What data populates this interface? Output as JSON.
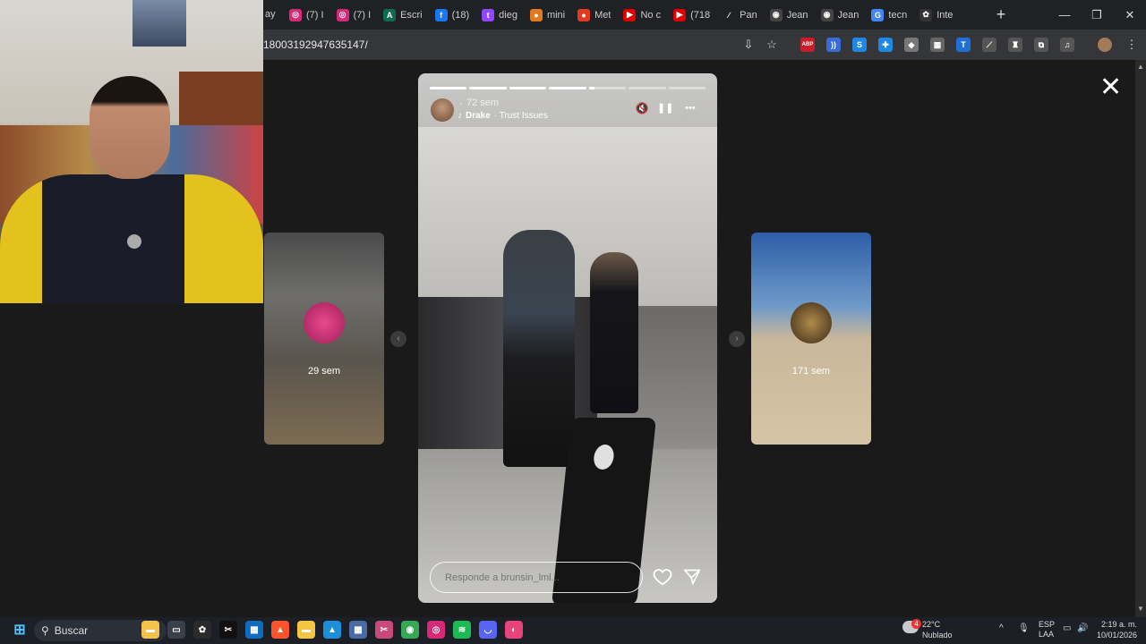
{
  "browser": {
    "tabs": [
      {
        "icon": "instagram-icon",
        "color": "#d62976",
        "letter": "◎",
        "label": "(7) I"
      },
      {
        "icon": "instagram-icon",
        "color": "#d62976",
        "letter": "◎",
        "label": "(7) I"
      },
      {
        "icon": "a-icon",
        "color": "#0f6b4f",
        "letter": "A",
        "label": "Escri"
      },
      {
        "icon": "facebook-icon",
        "color": "#1877f2",
        "letter": "f",
        "label": "(18)"
      },
      {
        "icon": "twitch-icon",
        "color": "#9146ff",
        "letter": "t",
        "label": "dieg"
      },
      {
        "icon": "pumpkin-icon",
        "color": "#e07a1f",
        "letter": "●",
        "label": "mini"
      },
      {
        "icon": "reddit-icon",
        "color": "#e03a1f",
        "letter": "●",
        "label": "Met"
      },
      {
        "icon": "youtube-icon",
        "color": "#e00000",
        "letter": "▶",
        "label": "No c"
      },
      {
        "icon": "youtube-icon",
        "color": "#e00000",
        "letter": "▶",
        "label": "(718"
      },
      {
        "icon": "text-icon",
        "color": "#202124",
        "letter": "∕",
        "label": "Pan"
      },
      {
        "icon": "globe-icon",
        "color": "#444",
        "letter": "◉",
        "label": "Jean"
      },
      {
        "icon": "globe-icon",
        "color": "#444",
        "letter": "◉",
        "label": "Jean"
      },
      {
        "icon": "google-icon",
        "color": "#4285f4",
        "letter": "G",
        "label": "tecn"
      },
      {
        "icon": "openai-icon",
        "color": "#333",
        "letter": "✿",
        "label": "Inte"
      }
    ],
    "first_tab_fragment": "ay",
    "url": "18003192947635147/",
    "new_tab": "+",
    "minimize": "—",
    "restore": "❐",
    "close": "✕",
    "extensions": [
      {
        "name": "adblock-icon",
        "label": "ABP",
        "color": "#c81e2b"
      },
      {
        "name": "wifi-ext-icon",
        "label": "))",
        "color": "#3a6bd6"
      },
      {
        "name": "shazam-icon",
        "label": "S",
        "color": "#1e88e5"
      },
      {
        "name": "puzzle-blue-icon",
        "label": "✚",
        "color": "#1e88e5"
      },
      {
        "name": "shield-ext-icon",
        "label": "◆",
        "color": "#777"
      },
      {
        "name": "bookmark-ext-icon",
        "label": "▦",
        "color": "#666"
      },
      {
        "name": "translate-ext-icon",
        "label": "T",
        "color": "#1f6fd6"
      },
      {
        "name": "eyedropper-icon",
        "label": "⟋",
        "color": "#555"
      },
      {
        "name": "game-ext-icon",
        "label": "♜",
        "color": "#555"
      },
      {
        "name": "extensions-icon",
        "label": "⧉",
        "color": "#555"
      },
      {
        "name": "media-icon",
        "label": "♫",
        "color": "#555"
      }
    ]
  },
  "story": {
    "dot": ".",
    "age": "72 sem",
    "music_artist": "Drake",
    "music_track": "· Trust Issues",
    "progress_segments": [
      1,
      1,
      1,
      1,
      0.15,
      0,
      0
    ],
    "reply_placeholder": "Responde a brunsin_lml...",
    "mute_icon": "🔇",
    "pause_icon": "❚❚",
    "more_icon": "•••"
  },
  "left_story": {
    "age": "29 sem"
  },
  "right_story": {
    "age": "171 sem"
  },
  "viewer": {
    "close": "✕",
    "prev": "‹",
    "next": "›"
  },
  "taskbar": {
    "search_label": "Buscar",
    "weather_temp": "22°C",
    "weather_desc": "Nublado",
    "weather_badge": "4",
    "lang_top": "ESP",
    "lang_bottom": "LAA",
    "time": "2:19 a. m.",
    "date": "10/01/2026",
    "apps": [
      {
        "name": "file-explorer-icon",
        "color": "#f2c14e",
        "label": "▬"
      },
      {
        "name": "task-view-icon",
        "color": "#3a3f4a",
        "label": "▭"
      },
      {
        "name": "chatgpt-icon",
        "color": "#2b2b2b",
        "label": "✿"
      },
      {
        "name": "capcut-icon",
        "color": "#111",
        "label": "✂"
      },
      {
        "name": "store-icon",
        "color": "#0f6cbd",
        "label": "▦"
      },
      {
        "name": "brave-icon",
        "color": "#fb542b",
        "label": "▲"
      },
      {
        "name": "folder-icon",
        "color": "#f4c542",
        "label": "▬"
      },
      {
        "name": "photos-icon",
        "color": "#1b8fd8",
        "label": "▲"
      },
      {
        "name": "calculator-icon",
        "color": "#4a6aa8",
        "label": "▦"
      },
      {
        "name": "snipping-icon",
        "color": "#c94a7a",
        "label": "✂"
      },
      {
        "name": "chrome-icon",
        "color": "#34a853",
        "label": "◉"
      },
      {
        "name": "instagram-icon",
        "color": "#d62976",
        "label": "◎"
      },
      {
        "name": "spotify-icon",
        "color": "#1db954",
        "label": "≋"
      },
      {
        "name": "discord-icon",
        "color": "#5865f2",
        "label": "◡"
      },
      {
        "name": "app-icon",
        "color": "#e8437a",
        "label": "◐"
      }
    ]
  }
}
